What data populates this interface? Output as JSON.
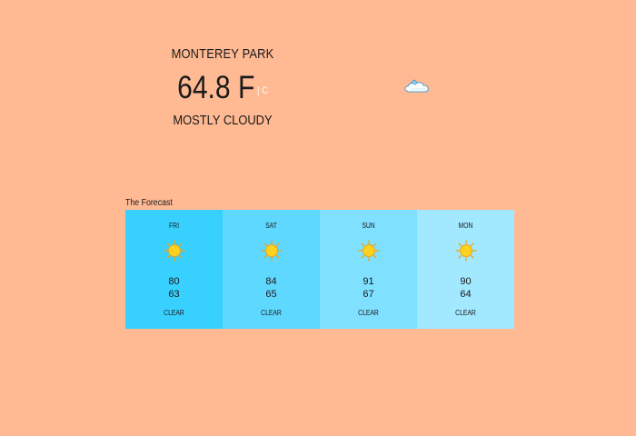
{
  "current": {
    "city": "MONTEREY PARK",
    "temperature": "64.8 F",
    "unit_toggle": "| C",
    "condition": "MOSTLY CLOUDY",
    "icon": "partly-cloudy-icon"
  },
  "forecast": {
    "label": "The Forecast",
    "days": [
      {
        "name": "FRI",
        "high": "80",
        "low": "63",
        "condition": "CLEAR",
        "icon": "sun-icon",
        "color": "#38D1FF"
      },
      {
        "name": "SAT",
        "high": "84",
        "low": "65",
        "condition": "CLEAR",
        "icon": "sun-icon",
        "color": "#5FD8FF"
      },
      {
        "name": "SUN",
        "high": "91",
        "low": "67",
        "condition": "CLEAR",
        "icon": "sun-icon",
        "color": "#7FE0FF"
      },
      {
        "name": "MON",
        "high": "90",
        "low": "64",
        "condition": "CLEAR",
        "icon": "sun-icon",
        "color": "#A2E8FF"
      }
    ]
  },
  "colors": {
    "background": "#FFBA94",
    "text": "#1A1A1A",
    "sun": "#FFD21F",
    "sun_outline": "#F2A20C"
  }
}
